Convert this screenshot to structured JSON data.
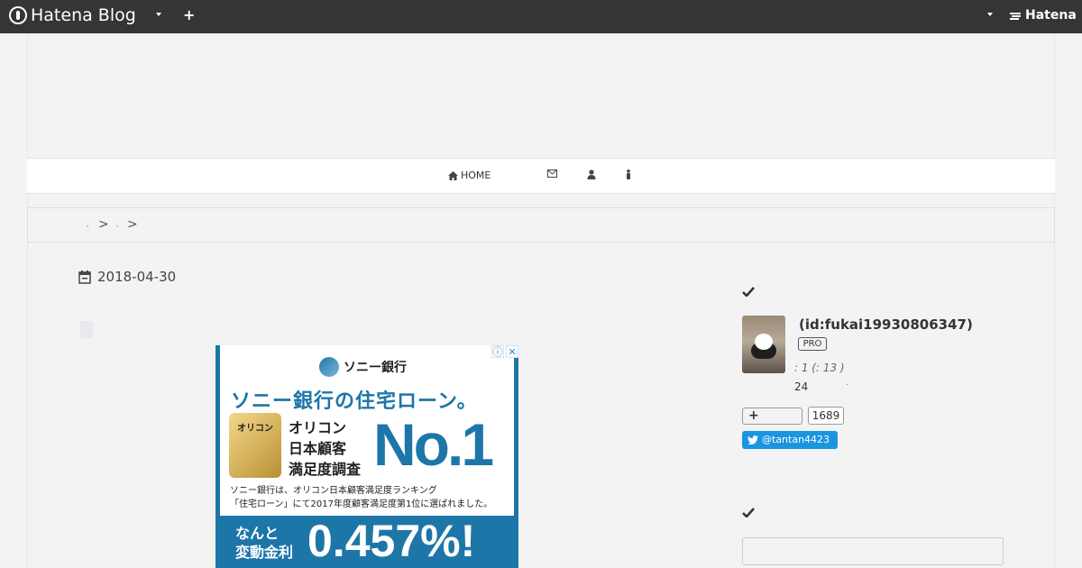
{
  "topbar": {
    "logo_text": "Hatena Blog",
    "plus_label": "+",
    "brand_text": "Hatena"
  },
  "nav": {
    "items": [
      {
        "label": "HOME",
        "icon": "home-icon"
      },
      {
        "label": "",
        "icon": "envelope-icon"
      },
      {
        "label": "",
        "icon": "user-icon"
      },
      {
        "label": "",
        "icon": "person-icon"
      }
    ]
  },
  "breadcrumb": {
    "separator": ">"
  },
  "article": {
    "date": "2018-04-30"
  },
  "ad": {
    "brand": "ソニー銀行",
    "headline": "ソニー銀行の住宅ローン。",
    "medal_label": "オリコン",
    "rank_lines": [
      "オリコン",
      "日本顧客",
      "満足度調査"
    ],
    "rank": "No.1",
    "note_lines": [
      "ソニー銀行は、オリコン日本顧客満足度ランキング",
      "「住宅ローン」にて2017年度顧客満足度第1位に選ばれました。"
    ],
    "bottom_lines": [
      "なんと",
      "変動金利"
    ],
    "rate": "0.457%!",
    "info_glyph": "ⓘ",
    "close_glyph": "✕"
  },
  "sidebar": {
    "profile": {
      "id_text": "(id:fukai19930806347)",
      "pro_badge": "PRO",
      "meta": ":        1 (:        13 )",
      "days": "24"
    },
    "follow": {
      "count": "1689"
    },
    "twitter": {
      "handle": "@tantan4423"
    }
  }
}
